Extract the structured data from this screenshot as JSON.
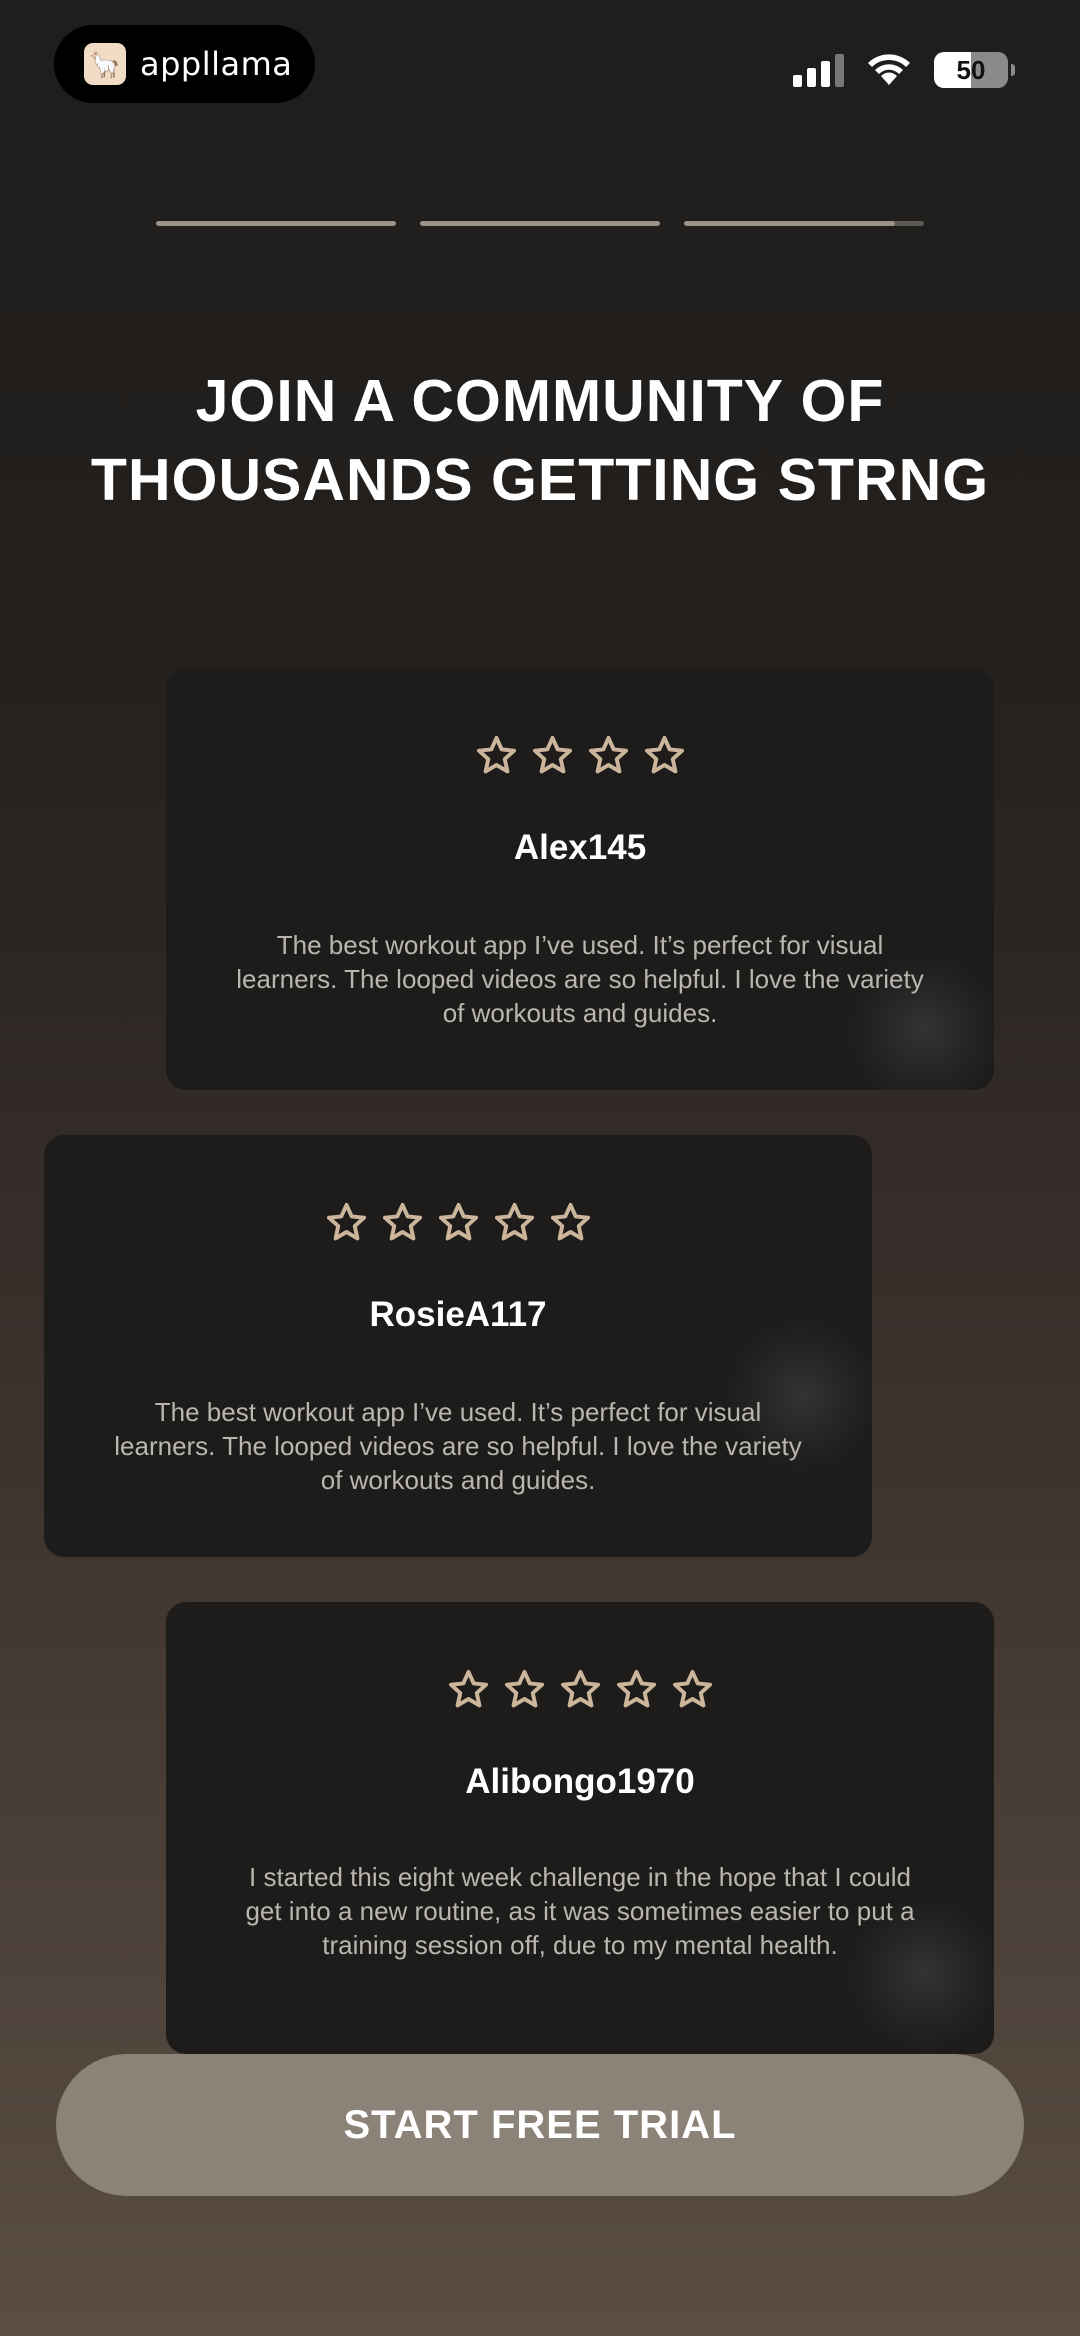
{
  "status_bar": {
    "brand_label": "appllama",
    "battery": "50",
    "battery_level": 0.5,
    "icons": [
      "signal-icon",
      "wifi-icon",
      "battery-icon"
    ]
  },
  "progress": {
    "segments": [
      1.0,
      1.0,
      0.88
    ]
  },
  "title": "JOIN A COMMUNITY OF THOUSANDS GETTING STRNG",
  "reviews": [
    {
      "name": "Alex145",
      "stars": 4,
      "text": "The best workout app I’ve used. It’s perfect for visual learners. The looped videos are so helpful. I love the variety of workouts and guides."
    },
    {
      "name": "RosieA117",
      "stars": 5,
      "text": "The best workout app I’ve used. It’s perfect for visual learners. The looped videos are so helpful. I love the variety of workouts and guides."
    },
    {
      "name": "Alibongo1970",
      "stars": 5,
      "text": "I started this eight week challenge in the hope that I could get into a new routine, as it was sometimes easier to put a training session off, due to my mental health."
    }
  ],
  "cta": {
    "label": "START FREE TRIAL"
  },
  "colors": {
    "star": "#cbb59b",
    "card": "#1d1c1b",
    "cta": "#8b8278",
    "progress_fill": "#9b9385"
  }
}
